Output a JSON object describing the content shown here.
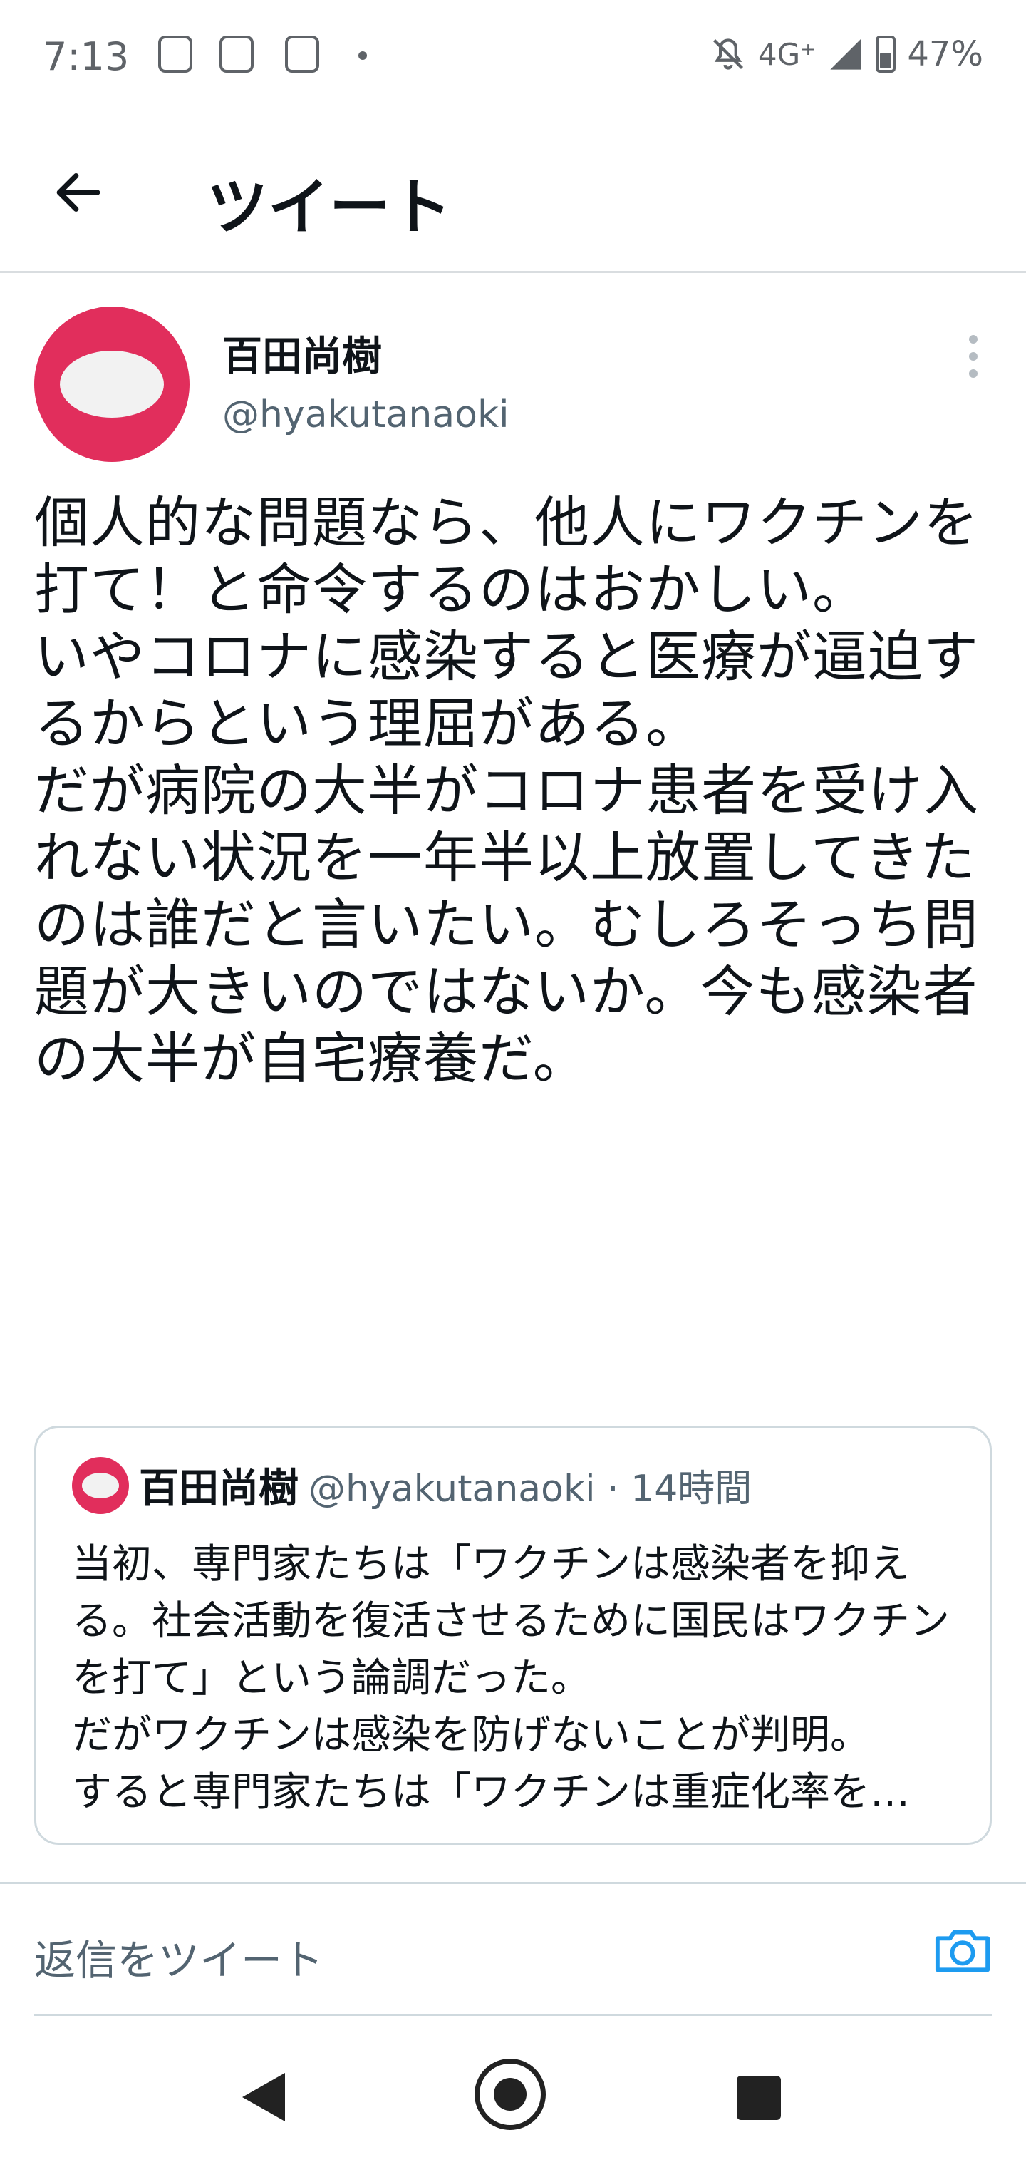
{
  "status_bar": {
    "time": "7:13",
    "network": "4G⁺",
    "battery": "47%"
  },
  "header": {
    "title": "ツイート"
  },
  "tweet": {
    "author_name": "百田尚樹",
    "author_handle": "@hyakutanaoki",
    "text": "個人的な問題なら、他人にワクチンを打て！と命令するのはおかしい。\nいやコロナに感染すると医療が逼迫するからという理屈がある。\nだが病院の大半がコロナ患者を受け入れない状況を一年半以上放置してきたのは誰だと言いたい。むしろそっち問題が大きいのではないか。今も感染者の大半が自宅療養だ。"
  },
  "quote": {
    "author_name": "百田尚樹",
    "author_handle": "@hyakutanaoki · 14時間",
    "text": "当初、専門家たちは「ワクチンは感染者を抑える。社会活動を復活させるために国民はワクチンを打て」という論調だった。\nだがワクチンは感染を防げないことが判明。\nすると専門家たちは「ワクチンは重症化率を…"
  },
  "reply": {
    "placeholder": "返信をツイート"
  },
  "colors": {
    "accent": "#1d9bf0",
    "avatar": "#e12e5c",
    "secondary_text": "#536471"
  }
}
